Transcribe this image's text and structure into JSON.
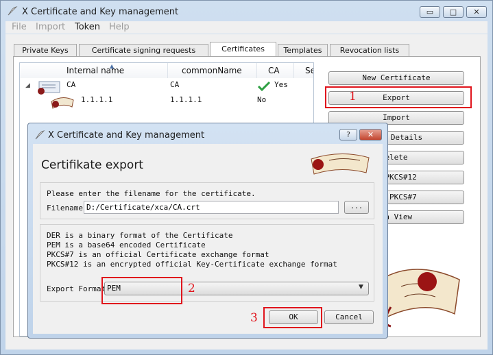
{
  "main": {
    "title": "X Certificate and Key management",
    "controls": {
      "minimize": "▭",
      "maximize": "□",
      "close": "✕"
    }
  },
  "menu": [
    "File",
    "Import",
    "Token",
    "Help"
  ],
  "tabs": [
    "Private Keys",
    "Certificate signing requests",
    "Certificates",
    "Templates",
    "Revocation lists"
  ],
  "selected_tab": "Certificates",
  "table": {
    "columns": [
      "Internal name",
      "commonName",
      "CA",
      "Se"
    ],
    "rows": [
      {
        "internal_name": "CA",
        "common_name": "CA",
        "ca": "Yes"
      },
      {
        "internal_name": "1.1.1.1",
        "common_name": "1.1.1.1",
        "ca": "No"
      }
    ]
  },
  "side_buttons": [
    "New Certificate",
    "Export",
    "Import",
    "Details",
    "elete",
    "t PKCS#12",
    "rt PKCS#7",
    "in View"
  ],
  "dialog": {
    "title": "X Certificate and Key management",
    "help": "?",
    "close": "✕",
    "heading": "Certifikate export",
    "prompt": "Please enter the filename for the certificate.",
    "filename_label": "Filename",
    "filename_value": "D:/Certificate/xca/CA.crt",
    "browse_label": "...",
    "info_lines": [
      "DER is a binary format of the Certificate",
      "PEM is a base64 encoded Certificate",
      "PKCS#7 is an official Certificate exchange format",
      "PKCS#12 is an encrypted official Key-Certificate exchange format"
    ],
    "format_label": "Export Format",
    "format_value": "PEM",
    "ok_label": "OK",
    "cancel_label": "Cancel"
  },
  "annotations": [
    "1",
    "2",
    "3"
  ],
  "colors": {
    "annotation": "#e0141c",
    "check": "#2ea043",
    "seal": "#8b1a1a"
  },
  "icons": [
    "app-feather-icon",
    "certificate-icon",
    "check-icon",
    "scroll-seal-icon"
  ]
}
